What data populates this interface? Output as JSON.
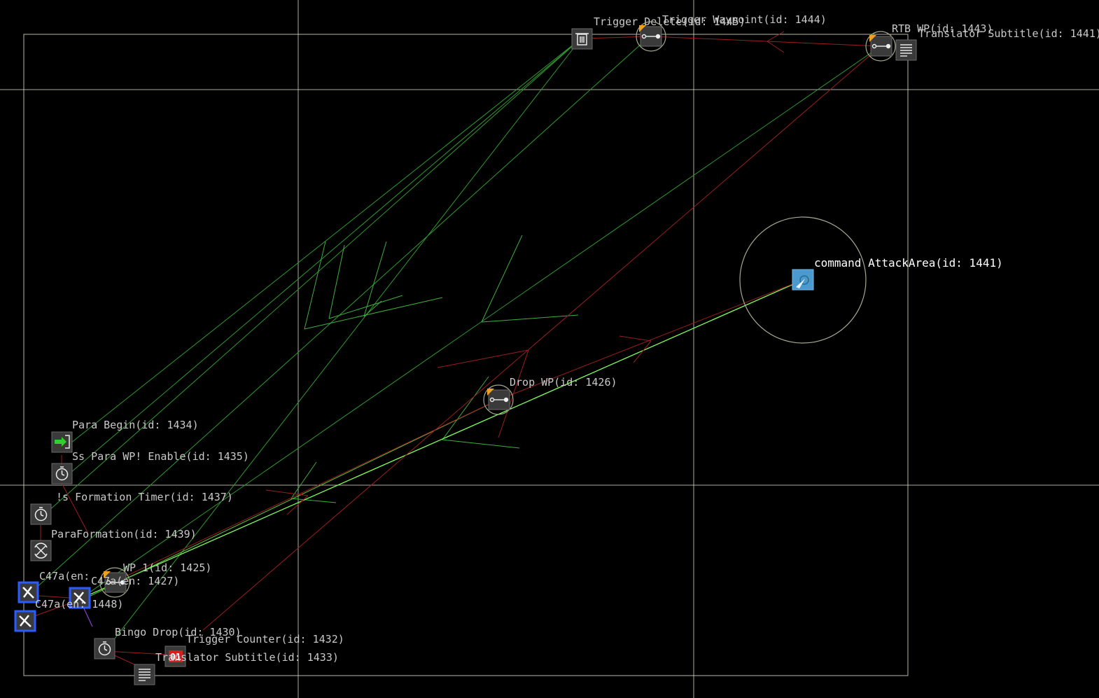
{
  "colors": {
    "background": "#000000",
    "grid": "#d9d9c6",
    "link_green": "#2f9a2f",
    "link_bright_green": "#7fff5a",
    "link_red": "#9a1e1e",
    "link_purple": "#8a3fd6",
    "unit_border": "#2a5cff",
    "label": "#c9c9c9"
  },
  "nodes": [
    {
      "key": "trigger_delete",
      "label": "Trigger Delete(id: 1445)",
      "icon": "trash-icon"
    },
    {
      "key": "trigger_waypoint",
      "label": "Trigger Waypoint(id: 1444)",
      "icon": "waypoint-icon"
    },
    {
      "key": "rtb_wp",
      "label": "RTB WP(id: 1443)",
      "icon": "waypoint-icon"
    },
    {
      "key": "translator_subtitle_top",
      "label": "Translator Subtitle(id: 1441)",
      "icon": "subtitle-icon"
    },
    {
      "key": "command_attackarea",
      "label": "command AttackArea(id: 1441)",
      "icon": "attack-area-icon"
    },
    {
      "key": "drop_wp",
      "label": "Drop WP(id: 1426)",
      "icon": "waypoint-icon"
    },
    {
      "key": "para_begin",
      "label": "Para Begin(id: 1434)",
      "icon": "enter-icon"
    },
    {
      "key": "ss_para_wp_enable",
      "label": "Ss Para WP! Enable(id: 1435)",
      "icon": "timer-icon"
    },
    {
      "key": "formation_timer",
      "label": "!s Formation Timer(id: 1437)",
      "icon": "timer-icon"
    },
    {
      "key": "paraformation",
      "label": "ParaFormation(id: 1439)",
      "icon": "formation-icon"
    },
    {
      "key": "wp1",
      "label": "WP 1(id: 1425)",
      "icon": "waypoint-icon"
    },
    {
      "key": "c47a_a",
      "label": "C47a(en:",
      "icon": "aircraft-icon"
    },
    {
      "key": "c47a_b",
      "label": "C47a(en: 1427)",
      "icon": "aircraft-icon"
    },
    {
      "key": "c47a_c",
      "label": "C47a(en: 1448)",
      "icon": "aircraft-icon"
    },
    {
      "key": "bingo_drop",
      "label": "Bingo Drop(id: 1430)",
      "icon": "timer-icon"
    },
    {
      "key": "trigger_counter",
      "label": "Trigger Counter(id: 1432)",
      "icon": "counter-icon"
    },
    {
      "key": "translator_subtitle_bottom",
      "label": "Translator Subtitle(id: 1433)",
      "icon": "subtitle-icon"
    }
  ],
  "counter_value": "01"
}
